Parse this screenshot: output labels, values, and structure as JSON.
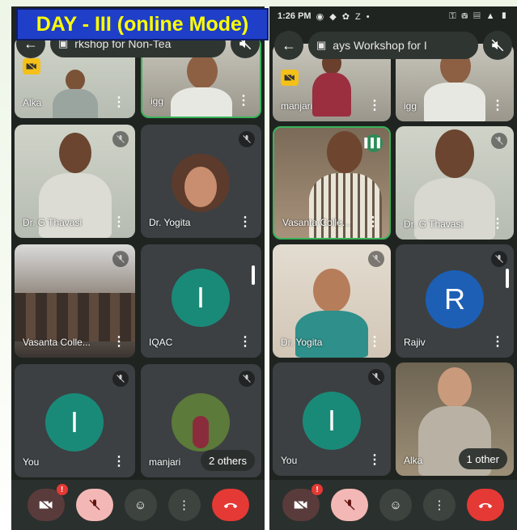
{
  "banner": {
    "text": "DAY - III (online Mode)"
  },
  "left_phone": {
    "title": "rkshop for Non-Tea",
    "tiles": [
      {
        "name": "Alka"
      },
      {
        "name": "igg"
      },
      {
        "name": "Dr. G Thavasi"
      },
      {
        "name": "Dr. Yogita"
      },
      {
        "name": "Vasanta Colle..."
      },
      {
        "name": "IQAC",
        "initial": "I"
      },
      {
        "name": "You",
        "initial": "I"
      },
      {
        "name": "manjari",
        "others": "2 others"
      }
    ]
  },
  "right_phone": {
    "status": {
      "time": "1:26 PM",
      "icons": "◉ ◆ ✿ Z •",
      "right": "⚿ ⛁ ▤ ▲ ▮"
    },
    "title": "ays Workshop for I",
    "tiles": [
      {
        "name": "manjari"
      },
      {
        "name": "igg"
      },
      {
        "name": "Vasanta Colle..."
      },
      {
        "name": "Dr. G Thavasi"
      },
      {
        "name": "Dr. Yogita"
      },
      {
        "name": "Rajiv",
        "initial": "R"
      },
      {
        "name": "You",
        "initial": "I"
      },
      {
        "name": "Alka",
        "others": "1 other"
      }
    ]
  },
  "colors": {
    "accent_green": "#3ab35a",
    "end_call": "#e53935",
    "avatar_teal": "#1a8a78",
    "avatar_blue": "#1c5fb5"
  }
}
